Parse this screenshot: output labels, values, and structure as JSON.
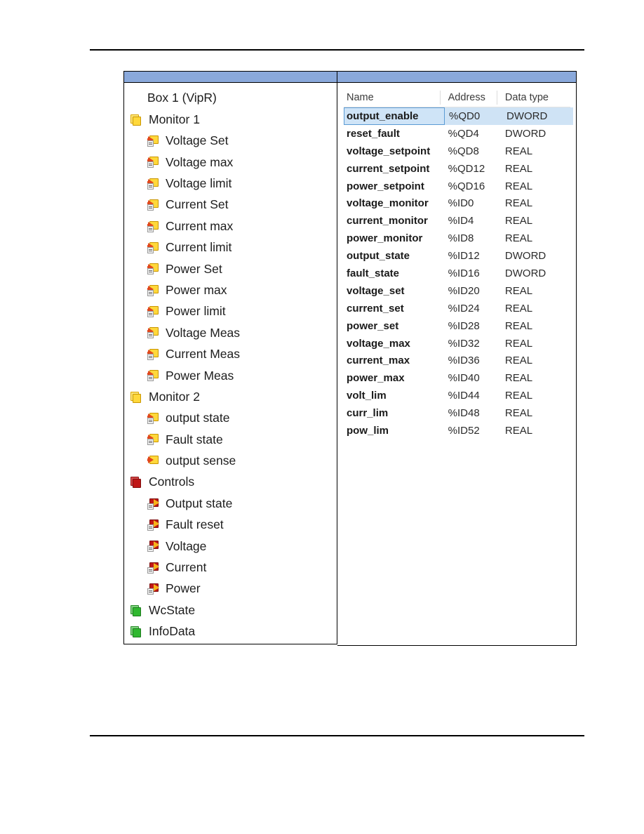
{
  "figure": {
    "left_pane": {
      "title_band_color": "#8AA9DB",
      "tree": [
        {
          "label": "Box 1 (VipR)",
          "depth": 0,
          "icon": "none"
        },
        {
          "label": "Monitor 1",
          "depth": 1,
          "icon": "yellow-stack-icon"
        },
        {
          "label": "Voltage Set",
          "depth": 2,
          "icon": "input-variable-icon"
        },
        {
          "label": "Voltage max",
          "depth": 2,
          "icon": "input-variable-icon"
        },
        {
          "label": "Voltage limit",
          "depth": 2,
          "icon": "input-variable-icon"
        },
        {
          "label": "Current Set",
          "depth": 2,
          "icon": "input-variable-icon"
        },
        {
          "label": "Current max",
          "depth": 2,
          "icon": "input-variable-icon"
        },
        {
          "label": "Current limit",
          "depth": 2,
          "icon": "input-variable-icon"
        },
        {
          "label": "Power Set",
          "depth": 2,
          "icon": "input-variable-icon"
        },
        {
          "label": "Power max",
          "depth": 2,
          "icon": "input-variable-icon"
        },
        {
          "label": "Power limit",
          "depth": 2,
          "icon": "input-variable-icon"
        },
        {
          "label": "Voltage Meas",
          "depth": 2,
          "icon": "input-variable-icon"
        },
        {
          "label": "Current  Meas",
          "depth": 2,
          "icon": "input-variable-icon"
        },
        {
          "label": "Power Meas",
          "depth": 2,
          "icon": "input-variable-icon"
        },
        {
          "label": "Monitor 2",
          "depth": 1,
          "icon": "yellow-stack-icon"
        },
        {
          "label": "output state",
          "depth": 2,
          "icon": "input-variable-icon"
        },
        {
          "label": "Fault state",
          "depth": 2,
          "icon": "input-variable-icon"
        },
        {
          "label": "output sense",
          "depth": 2,
          "icon": "input-variable-plain-icon"
        },
        {
          "label": "Controls",
          "depth": 1,
          "icon": "red-stack-icon"
        },
        {
          "label": "Output state",
          "depth": 2,
          "icon": "output-variable-icon"
        },
        {
          "label": "Fault reset",
          "depth": 2,
          "icon": "output-variable-icon"
        },
        {
          "label": "Voltage",
          "depth": 2,
          "icon": "output-variable-icon"
        },
        {
          "label": "Current",
          "depth": 2,
          "icon": "output-variable-icon"
        },
        {
          "label": "Power",
          "depth": 2,
          "icon": "output-variable-icon"
        },
        {
          "label": "WcState",
          "depth": 1,
          "icon": "green-stack-icon"
        },
        {
          "label": "InfoData",
          "depth": 1,
          "icon": "green-stack-icon"
        }
      ]
    },
    "right_pane": {
      "columns": [
        "Name",
        "Address",
        "Data type"
      ],
      "selected_row_index": 0,
      "selection_color": "#CFE3F5",
      "rows": [
        {
          "name": "output_enable",
          "address": "%QD0",
          "type": "DWORD"
        },
        {
          "name": "reset_fault",
          "address": "%QD4",
          "type": "DWORD"
        },
        {
          "name": "voltage_setpoint",
          "address": "%QD8",
          "type": "REAL"
        },
        {
          "name": "current_setpoint",
          "address": "%QD12",
          "type": "REAL"
        },
        {
          "name": "power_setpoint",
          "address": "%QD16",
          "type": "REAL"
        },
        {
          "name": "voltage_monitor",
          "address": "%ID0",
          "type": "REAL"
        },
        {
          "name": "current_monitor",
          "address": "%ID4",
          "type": "REAL"
        },
        {
          "name": "power_monitor",
          "address": "%ID8",
          "type": "REAL"
        },
        {
          "name": "output_state",
          "address": "%ID12",
          "type": "DWORD"
        },
        {
          "name": "fault_state",
          "address": "%ID16",
          "type": "DWORD"
        },
        {
          "name": "voltage_set",
          "address": "%ID20",
          "type": "REAL"
        },
        {
          "name": "current_set",
          "address": "%ID24",
          "type": "REAL"
        },
        {
          "name": "power_set",
          "address": "%ID28",
          "type": "REAL"
        },
        {
          "name": "voltage_max",
          "address": "%ID32",
          "type": "REAL"
        },
        {
          "name": "current_max",
          "address": "%ID36",
          "type": "REAL"
        },
        {
          "name": "power_max",
          "address": "%ID40",
          "type": "REAL"
        },
        {
          "name": "volt_lim",
          "address": "%ID44",
          "type": "REAL"
        },
        {
          "name": "curr_lim",
          "address": "%ID48",
          "type": "REAL"
        },
        {
          "name": "pow_lim",
          "address": "%ID52",
          "type": "REAL"
        }
      ]
    }
  }
}
